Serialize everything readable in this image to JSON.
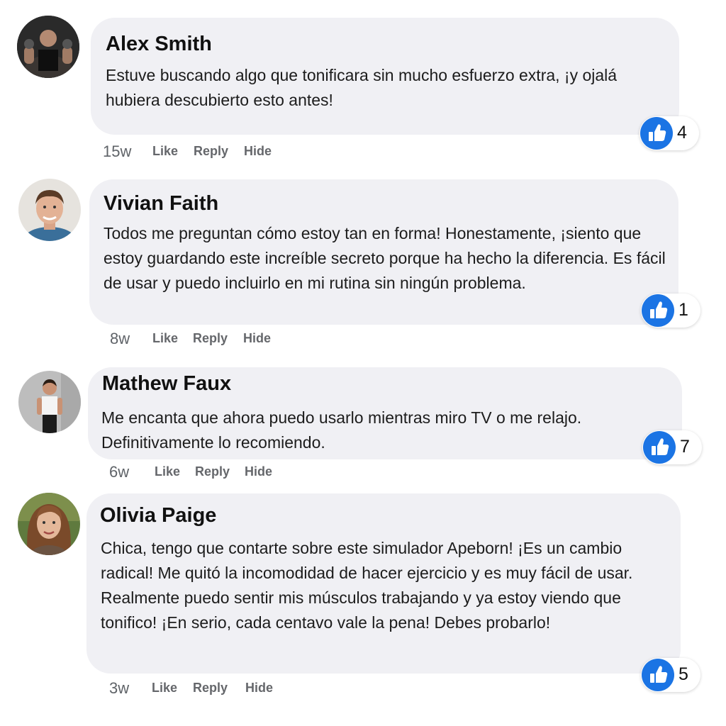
{
  "comments": [
    {
      "author": "Alex Smith",
      "text": "Estuve buscando algo que tonificara sin mucho esfuerzo extra, ¡y ojalá hubiera descubierto esto antes!",
      "time": "15w",
      "likes": "4",
      "actions": {
        "like": "Like",
        "reply": "Reply",
        "hide": "Hide"
      }
    },
    {
      "author": "Vivian Faith",
      "text": "Todos me preguntan cómo estoy tan en forma! Honestamente, ¡siento que estoy guardando este increíble secreto porque ha hecho la diferencia. Es fácil de usar y puedo incluirlo en mi rutina sin ningún problema.",
      "time": "8w",
      "likes": "1",
      "actions": {
        "like": "Like",
        "reply": "Reply",
        "hide": "Hide"
      }
    },
    {
      "author": "Mathew Faux",
      "text": "Me encanta que ahora puedo usarlo mientras miro TV o me relajo. Definitivamente lo recomiendo.",
      "time": "6w",
      "likes": "7",
      "actions": {
        "like": "Like",
        "reply": "Reply",
        "hide": "Hide"
      }
    },
    {
      "author": "Olivia Paige",
      "text": "Chica, tengo que contarte sobre este simulador Apeborn! ¡Es un cambio radical! Me quitó la incomodidad de hacer ejercicio y es muy fácil de usar. Realmente puedo sentir mis músculos trabajando y ya estoy viendo que tonifico! ¡En serio, cada centavo vale la pena! Debes probarlo!",
      "time": "3w",
      "likes": "5",
      "actions": {
        "like": "Like",
        "reply": "Reply",
        "hide": "Hide"
      }
    }
  ],
  "colors": {
    "bubble": "#f0f0f4",
    "like_blue": "#1b74e4",
    "meta_gray": "#65676b"
  },
  "icons": {
    "reaction": "thumbs-up-icon"
  }
}
